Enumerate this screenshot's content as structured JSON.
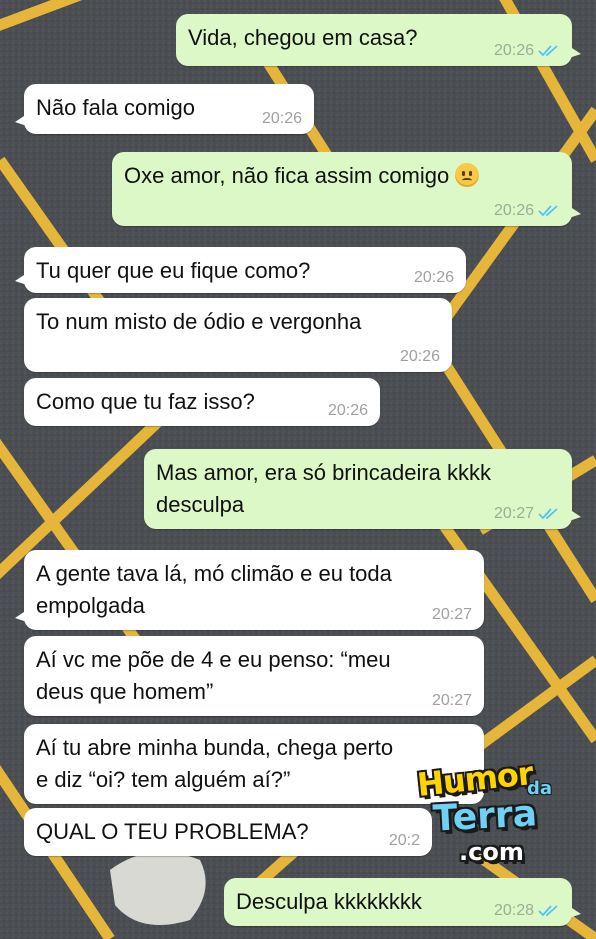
{
  "colors": {
    "incoming_bubble": "#ffffff",
    "outgoing_bubble": "#dcf8c6",
    "read_ticks": "#4fc3f7",
    "road_stripes": "#e5b63a",
    "asphalt": "#4a4d50"
  },
  "chat": {
    "messages": [
      {
        "dir": "out",
        "text_lines": [
          "Vida, chegou em casa?"
        ],
        "time": "20:26",
        "ticks": "read-double-check-icon"
      },
      {
        "dir": "in",
        "text_lines": [
          "Não fala comigo"
        ],
        "time": "20:26"
      },
      {
        "dir": "out",
        "text_lines": [
          "Oxe amor, não fica assim comigo"
        ],
        "emoji": "confused-face-emoji",
        "time": "20:26",
        "ticks": "read-double-check-icon"
      },
      {
        "dir": "in",
        "text_lines": [
          "Tu quer que eu fique como?"
        ],
        "time": "20:26"
      },
      {
        "dir": "in",
        "text_lines": [
          "To num misto de ódio e vergonha"
        ],
        "time": "20:26"
      },
      {
        "dir": "in",
        "text_lines": [
          "Como que tu faz isso?"
        ],
        "time": "20:26"
      },
      {
        "dir": "out",
        "text_lines": [
          "Mas amor, era só brincadeira kkkk",
          "desculpa"
        ],
        "time": "20:27",
        "ticks": "read-double-check-icon"
      },
      {
        "dir": "in",
        "text_lines": [
          "A gente tava lá, mó climão e eu toda",
          "empolgada"
        ],
        "time": "20:27"
      },
      {
        "dir": "in",
        "text_lines": [
          "Aí vc me põe de 4 e eu penso: “meu",
          "deus que homem”"
        ],
        "time": "20:27"
      },
      {
        "dir": "in",
        "text_lines": [
          "Aí tu abre minha bunda, chega perto",
          "e diz “oi? tem alguém aí?”"
        ],
        "time": ""
      },
      {
        "dir": "in",
        "text_lines": [
          "QUAL O TEU PROBLEMA?"
        ],
        "time": "20:2"
      },
      {
        "dir": "out",
        "text_lines": [
          "Desculpa kkkkkkkk"
        ],
        "time": "20:28",
        "ticks": "read-double-check-icon"
      }
    ]
  },
  "watermark": {
    "line1": "Humor",
    "line1b": "da",
    "line2": "Terra",
    "line3": ".com"
  }
}
